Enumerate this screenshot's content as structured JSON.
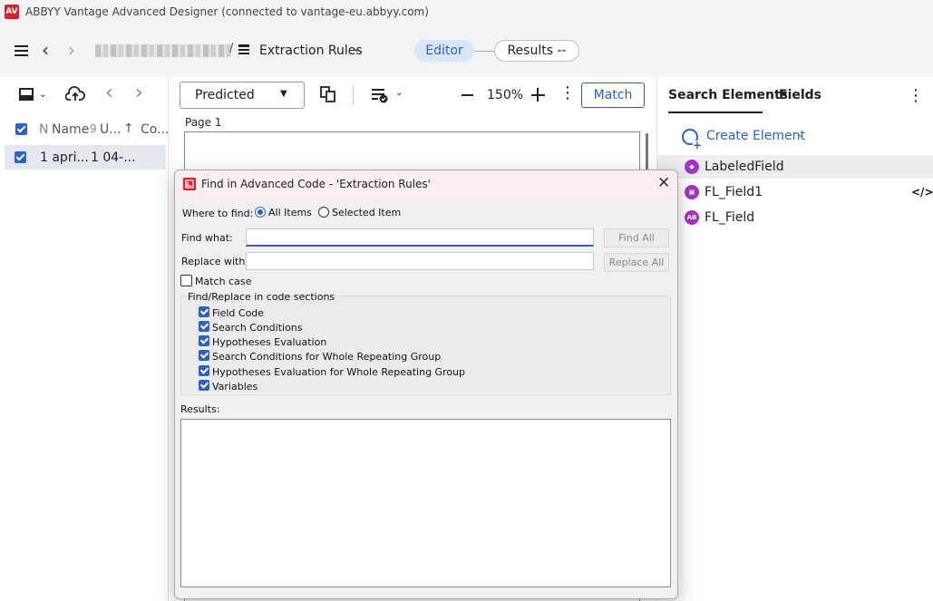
{
  "window": {
    "title": "ABBYY Vantage Advanced Designer (connected to vantage-eu.abbyy.com)",
    "logo_text": "AV"
  },
  "header": {
    "breadcrumb_separator": "/",
    "current_item": "Extraction Rules",
    "editor_label": "Editor",
    "results_label": "Results  --"
  },
  "left_pane": {
    "columns": {
      "name_prefix": "N",
      "name": "Name",
      "sort_prefix": "9",
      "updated": "U...",
      "sort_arrow": "↑",
      "comments": "Co..."
    },
    "rows": [
      {
        "name": "1 apri...",
        "updated": "1 04-..."
      }
    ]
  },
  "center": {
    "view_select": "Predicted",
    "zoom": "150%",
    "match_label": "Match",
    "page_label": "Page 1"
  },
  "right_pane": {
    "tabs": [
      "Search Elements",
      "Fields"
    ],
    "create_label": "Create Element",
    "elements": [
      {
        "label": "LabeledField",
        "icon": "tag-icon"
      },
      {
        "label": "FL_Field1",
        "icon": "fields-group-icon"
      },
      {
        "label": "FL_Field",
        "icon": "ab-text-icon",
        "icon_text": "AB"
      }
    ],
    "code_icon": "</>"
  },
  "dialog": {
    "title": "Find in Advanced Code - 'Extraction Rules'",
    "where_label": "Where to find:",
    "radio_all": "All Items",
    "radio_selected": "Selected Item",
    "where_value": "All Items",
    "find_label": "Find what:",
    "find_value": "",
    "replace_label": "Replace with:",
    "replace_value": "",
    "find_all": "Find All",
    "replace_all": "Replace All",
    "match_case": "Match case",
    "sections_label": "Find/Replace in code sections",
    "sections": [
      {
        "label": "Field Code",
        "checked": true
      },
      {
        "label": "Search Conditions",
        "checked": true
      },
      {
        "label": "Hypotheses Evaluation",
        "checked": true
      },
      {
        "label": "Search Conditions for Whole Repeating Group",
        "checked": true
      },
      {
        "label": "Hypotheses Evaluation for Whole Repeating Group",
        "checked": true
      },
      {
        "label": "Variables",
        "checked": true
      }
    ],
    "results_label": "Results:"
  },
  "colors": {
    "accent": "#2a62c9",
    "brand": "#d9202f",
    "element_icon": "#a533c9"
  }
}
